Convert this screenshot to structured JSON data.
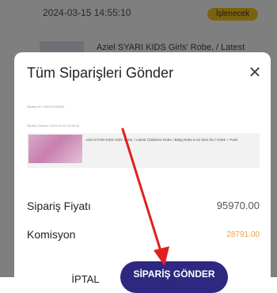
{
  "background": {
    "order_date": "2024-03-15 14:55:10",
    "status_badge": "İşlenecek",
    "product_title": "Aziel SYARI KIDS Girls' Robe, / Latest"
  },
  "modal": {
    "title": "Tüm Siparişleri Gönder",
    "close_icon": "close-icon",
    "order": {
      "meta_line_1": "Sipariş No: 240315145510",
      "meta_line_2": "Sipariş Zamanı: 2024-03-15 14:55:10",
      "product_description": "Aziel SYARI KIDS Girls' Robe, / Latest Childrens Robe / Batig Robe 6-12 Mon thu / Robe + Pash"
    },
    "summary": {
      "price_label": "Sipariş Fiyatı",
      "price_value": "95970.00",
      "commission_label": "Komisyon",
      "commission_value": "28791.00"
    },
    "buttons": {
      "cancel_label": "İPTAL",
      "send_label": "SİPARİŞ GÖNDER"
    }
  },
  "colors": {
    "primary": "#2e2880",
    "commission": "#f2a13a",
    "badge": "#f7c51a",
    "annotation_arrow": "#e02020"
  }
}
